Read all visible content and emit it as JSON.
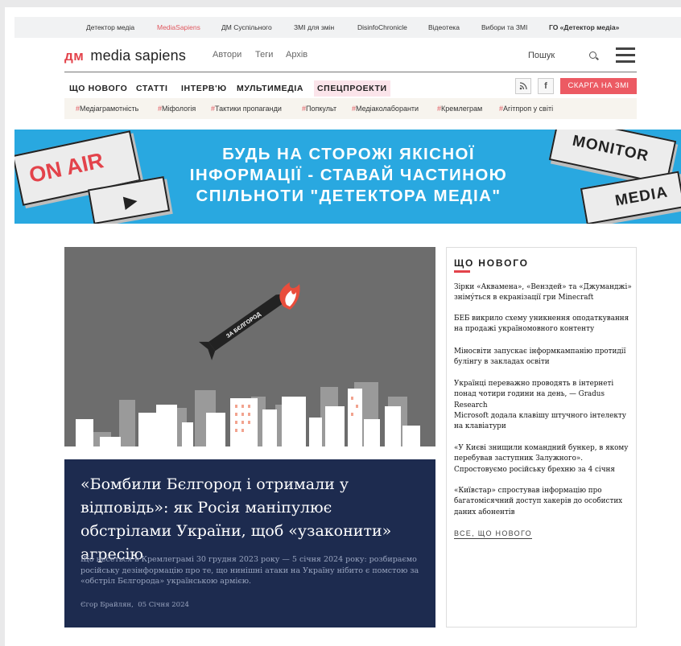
{
  "network_bar": {
    "items": [
      "Детектор медіа",
      "MediaSapiens",
      "ДМ Суспільного",
      "ЗМІ для змін",
      "DisinfoChronicle",
      "Відеотека",
      "Вибори та ЗМІ",
      "ГО «Детектор медіа»"
    ],
    "active_index": 1
  },
  "header": {
    "logo_mark": "дм",
    "logo_text": "media sapiens",
    "nav": [
      "Автори",
      "Теги",
      "Архів"
    ],
    "search_placeholder": "Пошук"
  },
  "main_nav": {
    "items": [
      "ЩО НОВОГО",
      "СТАТТІ",
      "ІНТЕРВ'Ю",
      "МУЛЬТИМЕДІА",
      "СПЕЦПРОЕКТИ"
    ],
    "highlighted_index": 4,
    "report_button": "СКАРГА НА ЗМІ"
  },
  "tags": {
    "prefix": "#",
    "items": [
      "Медіаграмотність",
      "Міфологія",
      "Тактики пропаганди",
      "Попкульт",
      "Медіаколаборанти",
      "Кремлеграм",
      "Агітпроп у світі"
    ]
  },
  "banner": {
    "lines": [
      "БУДЬ НА СТОРОЖІ ЯКІСНОЇ",
      "ІНФОРМАЦІЇ - СТАВАЙ ЧАСТИНОЮ",
      "СПІЛЬНОТИ \"ДЕТЕКТОРА МЕДІА\""
    ],
    "key_on_air": "ON AIR",
    "key_play": "▶",
    "key_monitor": "MONITOR",
    "key_media": "MEDIA"
  },
  "hero": {
    "rocket_label": "ЗА БЄЛГОРОД",
    "title": "«Бомбили Бєлгород і отримали у відповідь»: як Росія маніпулює обстрілами України, щоб «узаконити» агресію",
    "lead": "Що несеться в Кремлеграмі 30 грудня 2023 року — 5 січня 2024 року: розбираємо російську дезінформацію про те, що нинішні атаки на Україну нібито є помстою за «обстріл Бєлгорода» українською армією.",
    "author": "Єгор Брайлян",
    "date": "05 Січня 2024"
  },
  "sidebar": {
    "heading": "ЩО НОВОГО",
    "news": [
      "Зірки «Аквамена», «Венздей» та «Джуманджі» зніму́ться в екранізації гри Minecraft",
      "БЕБ викрило схему уникнення оподаткування на продажі україномовного контенту",
      "Міносвіти запускає інформкампанію протидії булінгу в закладах освіти",
      "Українці переважно проводять в інтернеті понад чотири години на день, — Gradus Research",
      "Microsoft додала клавішу штучного інтелекту на клавіатури",
      "«У Києві знищили командний бункер, в якому перебував заступник Залужного». Спростовуємо російську брехню за 4 січня",
      "«Київстар» спростував інформацію про багатомісячний доступ хакерів до особистих даних абонентів"
    ],
    "all_link": "ВСЕ, ЩО НОВОГО"
  },
  "colors": {
    "accent": "#e3434b",
    "banner": "#29a8e0",
    "hero_bg": "#1d2b4f",
    "tag_bg": "#f7f4ee"
  }
}
